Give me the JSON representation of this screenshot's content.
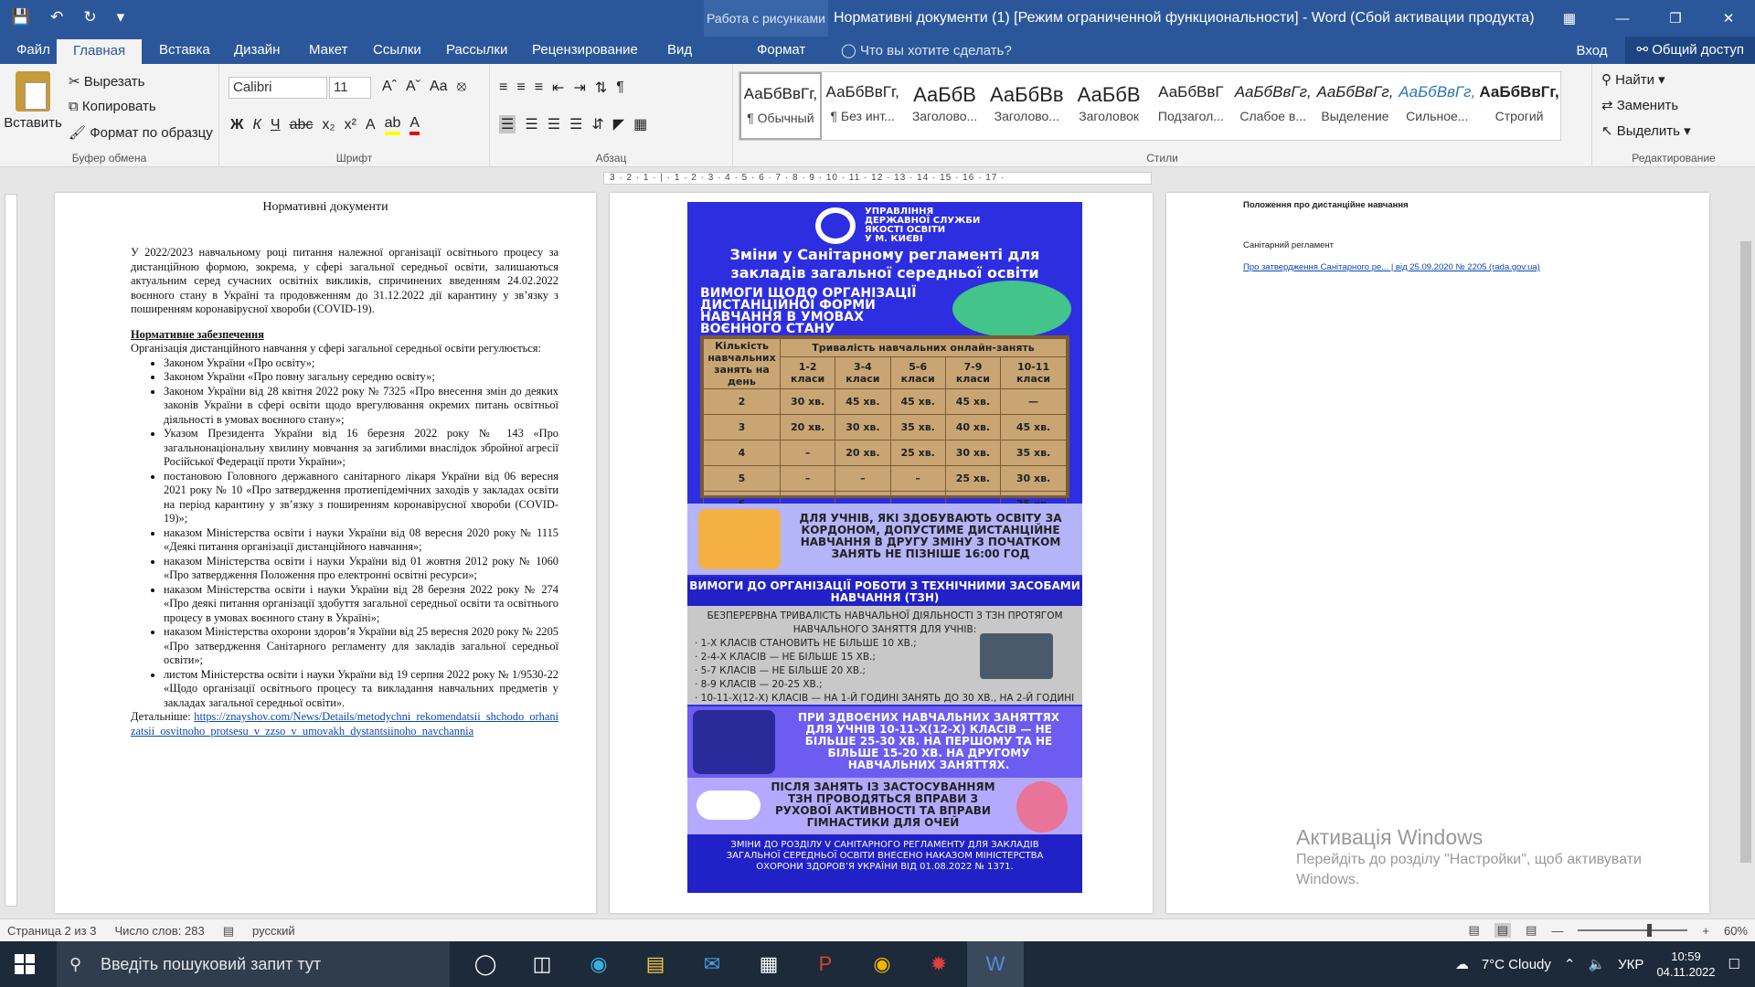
{
  "titlebar": {
    "context_tab": "Работа с рисунками",
    "title": "Нормативні документи (1) [Режим ограниченной функциональности] - Word (Сбой активации продукта)"
  },
  "tabs": {
    "file": "Файл",
    "home": "Главная",
    "insert": "Вставка",
    "design": "Дизайн",
    "layout": "Макет",
    "references": "Ссылки",
    "mailings": "Рассылки",
    "review": "Рецензирование",
    "view": "Вид",
    "format": "Формат",
    "tell_me": "Что вы хотите сделать?",
    "signin": "Вход",
    "share": "Общий доступ"
  },
  "ribbon": {
    "clipboard": {
      "paste": "Вставить",
      "cut": "Вырезать",
      "copy": "Копировать",
      "format_painter": "Формат по образцу",
      "label": "Буфер обмена"
    },
    "font": {
      "name": "Calibri",
      "size": "11",
      "label": "Шрифт"
    },
    "paragraph": {
      "label": "Абзац"
    },
    "styles": {
      "label": "Стили",
      "items": [
        {
          "preview": "АаБбВвГг,",
          "name": "¶ Обычный"
        },
        {
          "preview": "АаБбВвГг,",
          "name": "¶ Без инт..."
        },
        {
          "preview": "АаБбВ",
          "name": "Заголово..."
        },
        {
          "preview": "АаБбВв",
          "name": "Заголово..."
        },
        {
          "preview": "АаБбВ",
          "name": "Заголовок"
        },
        {
          "preview": "АаБбВвГ",
          "name": "Подзагол..."
        },
        {
          "preview": "АаБбВвГг,",
          "name": "Слабое в..."
        },
        {
          "preview": "АаБбВвГг,",
          "name": "Выделение"
        },
        {
          "preview": "АаБбВвГг,",
          "name": "Сильное..."
        },
        {
          "preview": "АаБбВвГг,",
          "name": "Строгий"
        }
      ]
    },
    "editing": {
      "find": "Найти",
      "replace": "Заменить",
      "select": "Выделить",
      "label": "Редактирование"
    }
  },
  "ruler": {
    "text": "3 · 2 · 1 · | · 1 · 2 · 3 · 4 · 5 · 6 · 7 · 8 · 9 · 10 · 11 · 12 · 13 · 14 · 15 · 16 · 17 ·"
  },
  "page1": {
    "title": "Нормативні документи",
    "intro": "У 2022/2023 навчальному році питання належної організації освітнього процесу за дистанційною формою, зокрема, у сфері загальної середньої освіти, залишаються актуальним серед сучасних освітніх викликів, спричинених введенням 24.02.2022 воєнного стану в Україні та продовженням до 31.12.2022 дії карантину у зв’язку з поширенням коронавірусної хвороби (COVID-19).",
    "heading": "Нормативне забезпечення",
    "lead": "Організація дистанційного навчання у сфері загальної середньої освіти регулюється:",
    "items": [
      "Законом України «Про освіту»;",
      "Законом України «Про повну загальну середню освіту»;",
      "Законом України від 28 квітня 2022 року № 7325 «Про внесення змін до деяких законів України в сфері освіти щодо врегулювання окремих питань освітньої діяльності в умовах воєнного стану»;",
      "Указом Президента України від 16 березня 2022 року № 143 «Про загальнонаціональну хвилину мовчання за загиблими внаслідок збройної агресії Російської Федерації проти України»;",
      "постановою Головного державного санітарного лікаря України від 06 вересня 2021 року № 10 «Про затвердження протиепідемічних заходів у закладах освіти на період карантину у зв’язку з поширенням коронавірусної хвороби (COVID-19)»;",
      "наказом Міністерства освіти і науки України від 08 вересня 2020 року № 1115 «Деякі питання організації дистанційного навчання»;",
      "наказом Міністерства освіти і науки України від 01 жовтня 2012 року № 1060 «Про затвердження Положення про електронні освітні ресурси»;",
      "наказом Міністерства освіти і науки України від 28 березня 2022 року № 274 «Про деякі питання організації здобуття загальної середньої освіти та освітнього процесу в умовах воєнного стану в Україні»;",
      "наказом Міністерства охорони здоров’я України від 25 вересня 2020 року № 2205 «Про затвердження Санітарного регламенту для закладів загальної середньої освіти»;",
      "листом Міністерства освіти і науки України від 19 серпня 2022 року № 1/9530-22 «Щодо організації освітнього процесу та викладання навчальних предметів у закладах загальної середньої освіти»."
    ],
    "more_label": "Детальніше: ",
    "more_link": "https://znayshov.com/News/Details/metodychni_rekomendatsii_shchodo_orhanizatsii_osvitnoho_protsesu_v_zzso_v_umovakh_dystantsiinoho_navchannia"
  },
  "poster": {
    "org": [
      "УПРАВЛІННЯ",
      "ДЕРЖАВНОЇ СЛУЖБИ",
      "ЯКОСТІ ОСВІТИ",
      "У М. КИЄВІ"
    ],
    "headline": "Зміни у Санітарному регламенті для закладів загальної середньої освіти",
    "sub": "ВИМОГИ ЩОДО ОРГАНІЗАЦІЇ ДИСТАНЦІЙНОЇ ФОРМИ НАВЧАННЯ В УМОВАХ ВОЄННОГО СТАНУ",
    "table": {
      "col0": "Кількість навчальних занять на день",
      "colspan": "Тривалість навчальних онлайн-занять",
      "headers": [
        "1-2 класи",
        "3-4 класи",
        "5-6 класи",
        "7-9 класи",
        "10-11 класи"
      ],
      "rows": [
        [
          "2",
          "30 хв.",
          "45 хв.",
          "45 хв.",
          "45 хв.",
          "—"
        ],
        [
          "3",
          "20 хв.",
          "30 хв.",
          "35 хв.",
          "40 хв.",
          "45 хв."
        ],
        [
          "4",
          "–",
          "20 хв.",
          "25 хв.",
          "30 хв.",
          "35 хв."
        ],
        [
          "5",
          "–",
          "–",
          "–",
          "25 хв.",
          "30 хв."
        ],
        [
          "6",
          "–",
          "–",
          "–",
          "–",
          "25 хв."
        ]
      ]
    },
    "abroad": "ДЛЯ УЧНІВ, ЯКІ ЗДОБУВАЮТЬ ОСВІТУ ЗА КОРДОНОМ, ДОПУСТИМЕ ДИСТАНЦІЙНЕ НАВЧАННЯ В ДРУГУ ЗМІНУ З ПОЧАТКОМ ЗАНЯТЬ НЕ ПІЗНІШЕ 16:00 ГОД",
    "tzn_title": "ВИМОГИ ДО ОРГАНІЗАЦІЇ РОБОТИ З ТЕХНІЧНИМИ ЗАСОБАМИ НАВЧАННЯ (ТЗН)",
    "tzn_intro": "БЕЗПЕРЕРВНА ТРИВАЛІСТЬ НАВЧАЛЬНОЇ ДІЯЛЬНОСТІ З ТЗН ПРОТЯГОМ НАВЧАЛЬНОГО ЗАНЯТТЯ ДЛЯ УЧНІВ:",
    "tzn_items": [
      "· 1-Х КЛАСІВ СТАНОВИТЬ НЕ БІЛЬШЕ 10 ХВ.;",
      "· 2-4-Х КЛАСІВ — НЕ БІЛЬШЕ 15 ХВ.;",
      "· 5-7 КЛАСІВ — НЕ БІЛЬШЕ 20 ХВ.;",
      "· 8-9 КЛАСІВ — 20-25 ХВ.;",
      "· 10-11-Х(12-Х) КЛАСІВ — НА 1-Й ГОДИНІ ЗАНЯТЬ ДО 30 ХВ., НА 2-Й ГОДИНІ ЗАНЯТЬ — 20 ХВ."
    ],
    "double": "ПРИ ЗДВОЄНИХ НАВЧАЛЬНИХ ЗАНЯТТЯХ ДЛЯ УЧНІВ 10-11-Х(12-Х) КЛАСІВ — НЕ БІЛЬШЕ 25-30 ХВ. НА ПЕРШОМУ ТА НЕ БІЛЬШЕ 15-20 ХВ. НА ДРУГОМУ НАВЧАЛЬНИХ ЗАНЯТТЯХ.",
    "exercise": "ПІСЛЯ ЗАНЯТЬ ІЗ ЗАСТОСУВАННЯМ ТЗН ПРОВОДЯТЬСЯ ВПРАВИ З РУХОВОЇ АКТИВНОСТІ ТА ВПРАВИ ГІМНАСТИКИ ДЛЯ ОЧЕЙ",
    "footer": "ЗМІНИ ДО РОЗДІЛУ V САНІТАРНОГО РЕГЛАМЕНТУ ДЛЯ ЗАКЛАДІВ ЗАГАЛЬНОЇ СЕРЕДНЬОЇ ОСВІТИ ВНЕСЕНО НАКАЗОМ МІНІСТЕРСТВА ОХОРОНИ ЗДОРОВ’Я УКРАЇНИ ВІД 01.08.2022 № 1371."
  },
  "page3": {
    "title": "Положення про дистанційне навчання",
    "label": "Санітарний регламент",
    "link": "Про затвердження Санітарного ре... | від 25.09.2020 № 2205 (rada.gov.ua)"
  },
  "activation": {
    "title": "Активація Windows",
    "text": "Перейдіть до розділу \"Настройки\", щоб активувати Windows."
  },
  "status": {
    "page": "Страница 2 из 3",
    "words": "Число слов: 283",
    "lang": "русский",
    "zoom": "60%"
  },
  "taskbar": {
    "search": "Введіть пошуковий запит тут",
    "weather": "7°C  Cloudy",
    "lang": "УКР",
    "time": "10:59",
    "date": "04.11.2022"
  }
}
